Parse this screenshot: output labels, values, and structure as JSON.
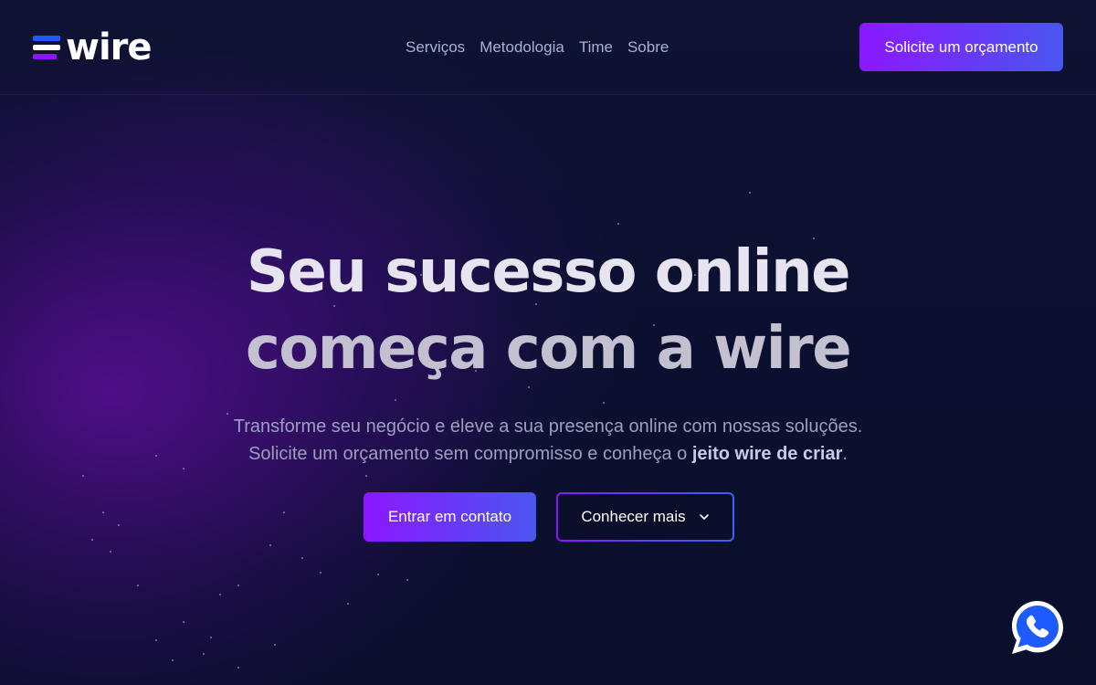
{
  "brand": {
    "name": "wire",
    "colors": {
      "accent_start": "#8b17ff",
      "accent_end": "#4a56f0",
      "background": "#0b0f2c",
      "whatsapp": "#1e5bff"
    }
  },
  "nav": {
    "items": [
      {
        "label": "Serviços"
      },
      {
        "label": "Metodologia"
      },
      {
        "label": "Time"
      },
      {
        "label": "Sobre"
      }
    ]
  },
  "header": {
    "cta_label": "Solicite um orçamento"
  },
  "hero": {
    "title_line1": "Seu sucesso online",
    "title_line2": "começa com a wire",
    "subtitle_line1": "Transforme seu negócio e eleve a sua presença online com nossas soluções.",
    "subtitle_line2_prefix": "Solicite um orçamento sem compromisso e conheça o ",
    "subtitle_line2_bold": "jeito wire de criar",
    "subtitle_line2_suffix": ".",
    "primary_button": "Entrar em contato",
    "secondary_button": "Conhecer mais"
  },
  "icons": {
    "logo": "wire-logo-icon",
    "secondary_button": "chevron-down-icon",
    "floating": "whatsapp-icon"
  }
}
